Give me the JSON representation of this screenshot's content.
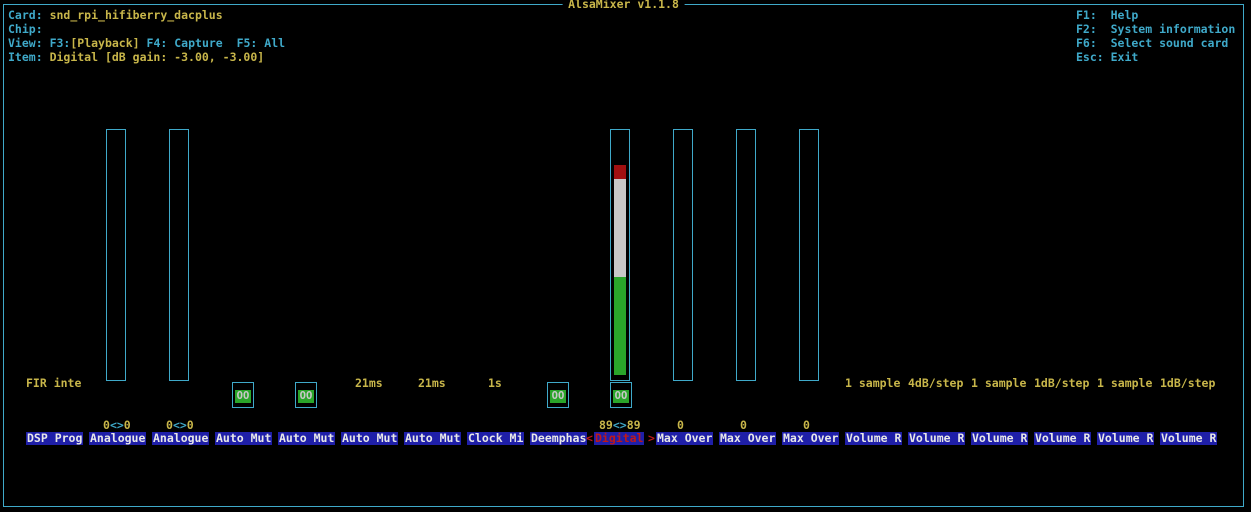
{
  "app": {
    "title": "AlsaMixer v1.1.8"
  },
  "info": {
    "card_key": "Card:",
    "card_val": "snd_rpi_hifiberry_dacplus",
    "chip_key": "Chip:",
    "chip_val": "",
    "view_key": "View:",
    "view_f3": "F3:",
    "view_playback": "[Playback]",
    "view_f4": "F4:",
    "view_capture": "Capture",
    "view_f5": "F5:",
    "view_all": "All",
    "item_key": "Item:",
    "item_val": "Digital [dB gain: -3.00, -3.00]"
  },
  "help": {
    "f1": "F1:  Help",
    "f2": "F2:  System information",
    "f6": "F6:  Select sound card",
    "esc": "Esc: Exit"
  },
  "colors": {
    "border": "#3fa9c9",
    "yellow": "#c8b64a",
    "green": "#2aa52a",
    "blue": "#1f1fa8",
    "red": "#c01818"
  },
  "controls": [
    {
      "name": "DSP Prog",
      "value_text": "FIR inte"
    },
    {
      "name": "Analogue",
      "level": 0,
      "num_l": "0",
      "num_r": "0"
    },
    {
      "name": "Analogue",
      "level": 0,
      "num_l": "0",
      "num_r": "0"
    },
    {
      "name": "Auto Mut",
      "switch": "OO"
    },
    {
      "name": "Auto Mut",
      "switch": "OO"
    },
    {
      "name": "Auto Mut",
      "value_text": "21ms"
    },
    {
      "name": "Auto Mut",
      "value_text": "21ms"
    },
    {
      "name": "Clock Mi",
      "value_text": "1s"
    },
    {
      "name": "Deemphas",
      "switch": "OO"
    },
    {
      "name": "Digital",
      "selected": true,
      "level": 0.89,
      "num_l": "89",
      "num_r": "89",
      "switch": "OO"
    },
    {
      "name": "Max Over",
      "num": "0"
    },
    {
      "name": "Max Over",
      "num": "0"
    },
    {
      "name": "Max Over",
      "num": "0"
    },
    {
      "name": "Volume R",
      "value_text": "1 sample"
    },
    {
      "name": "Volume R",
      "value_text": "4dB/step"
    },
    {
      "name": "Volume R",
      "value_text": "1 sample"
    },
    {
      "name": "Volume R",
      "value_text": "1dB/step"
    },
    {
      "name": "Volume R",
      "value_text": "1 sample"
    },
    {
      "name": "Volume R",
      "value_text": "1dB/step"
    }
  ]
}
